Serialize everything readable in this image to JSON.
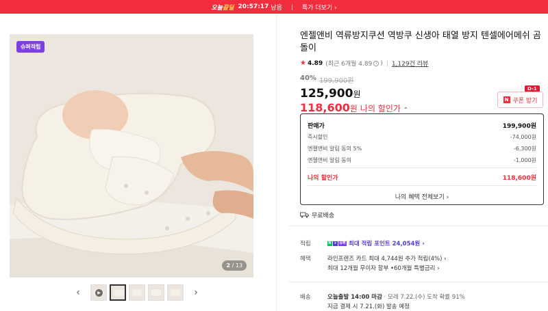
{
  "banner": {
    "tag_prefix": "오늘",
    "tag_highlight": "끝딜",
    "timer": "20:57:17",
    "suffix": "남음",
    "more": "특가 더보기 ›"
  },
  "image": {
    "badge": "슈퍼적립",
    "counter_current": "2",
    "counter_sep": " / ",
    "counter_total": "13"
  },
  "thumbs": {
    "prev": "‹",
    "next": "›",
    "play": "▶"
  },
  "product": {
    "title": "엔젤앤비 역류방지쿠션 역방쿠 신생아 태열 방지 텐셀에어메쉬 곰돌이",
    "rating": "4.89",
    "recent": "(최근 6개월 4.89",
    "recent_close": ")",
    "info_mark": "i",
    "reviews": "1,129건 리뷰",
    "discount_pct": "40%",
    "original_price": "199,900원",
    "price": "125,900",
    "price_unit": "원",
    "my_price": "118,600",
    "my_price_unit": "원",
    "my_price_label": "나의 할인가",
    "caret": "⌃"
  },
  "coupon": {
    "n": "N",
    "label": "쿠폰 받기",
    "dday": "D-1"
  },
  "breakdown": {
    "head_label": "판매가",
    "head_value": "199,900원",
    "rows": [
      {
        "label": "즉시할인",
        "value": "-74,000원"
      },
      {
        "label": "엔젤앤비 알림 동의 5%",
        "value": "-6,300원"
      },
      {
        "label": "엔젤앤비 알림 동의",
        "value": "-1,000원"
      }
    ],
    "mine_label": "나의 할인가",
    "mine_value": "118,600원",
    "all_benefits": "나의 혜택 전체보기 ›"
  },
  "shipping_free": "무료배송",
  "details": {
    "point_key": "적립",
    "point_value": "최대 적립 포인트 24,054원 ›",
    "benefit_key": "혜택",
    "benefit_line1": "라인프렌즈 카드 최대 4,744원 추가 적립(4%) ›",
    "benefit_line2": "최대 12개월 무이자 할부 •60개월 특별금리 ›",
    "delivery_key": "배송",
    "delivery_line1_bold": "오늘출발 14:00 마감",
    "delivery_line1_rest": "· 모레 7.22.(수) 도착 확률 91%",
    "delivery_line2": "지금 결제 시 7.21.(화) 발송 예정"
  },
  "colors": {
    "brand_red": "#f22d3d",
    "point_purple": "#4e3dd6",
    "badge_purple": "#7b3fe4"
  }
}
